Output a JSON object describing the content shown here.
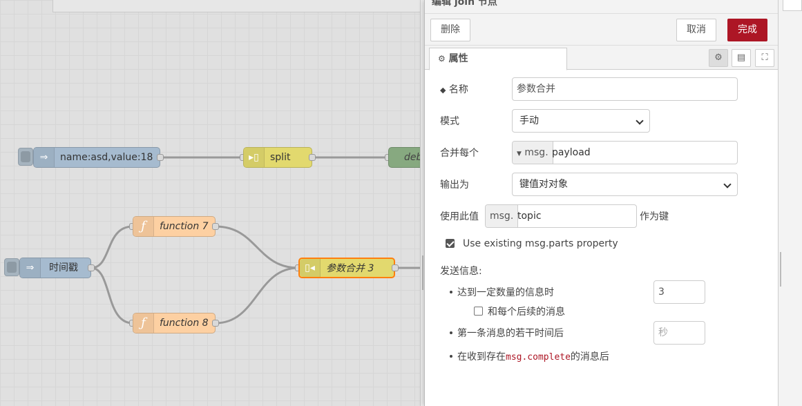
{
  "panel": {
    "title": "编辑 join 节点",
    "delete_label": "删除",
    "cancel_label": "取消",
    "done_label": "完成",
    "tab_label": "属性",
    "name_label": "名称",
    "name_value": "参数合并",
    "mode_label": "模式",
    "mode_value": "手动",
    "combine_label": "合并每个",
    "combine_prefix": "msg.",
    "combine_value": "payload",
    "output_label": "输出为",
    "output_value": "键值对对象",
    "use_value_label": "使用此值",
    "use_value_prefix": "msg.",
    "use_value_value": "topic",
    "as_key_label": "作为键",
    "use_parts_label": "Use existing msg.parts property",
    "use_parts_checked": true,
    "send_label": "发送信息:",
    "count_label": "达到一定数量的信息时",
    "count_value": "3",
    "subsequent_label": "和每个后续的消息",
    "subsequent_checked": false,
    "timeout_label": "第一条消息的若干时间后",
    "timeout_placeholder": "秒",
    "complete_before": "在收到存在",
    "complete_code": "msg.complete",
    "complete_after": "的消息后"
  },
  "flow": {
    "nodes": {
      "inject1": "name:asd,value:18",
      "split": "split",
      "debug": "debug",
      "func7": "function 7",
      "inject2": "时间戳",
      "join": "参数合并 3",
      "func8": "function 8"
    }
  }
}
